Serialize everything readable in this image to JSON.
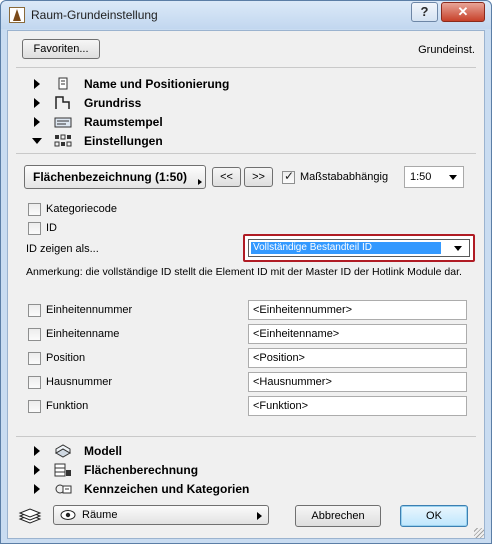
{
  "window": {
    "title": "Raum-Grundeinstellung",
    "help_label": "?",
    "close_label": "✕"
  },
  "header": {
    "favorites_label": "Favoriten...",
    "right_label": "Grundeinst."
  },
  "sections": {
    "name": "Name und Positionierung",
    "grundriss": "Grundriss",
    "raumstempel": "Raumstempel",
    "einstellungen": "Einstellungen",
    "modell": "Modell",
    "flaechen": "Flächenberechnung",
    "kennzeichen": "Kennzeichen und Kategorien"
  },
  "settings": {
    "area_button": "Flächenbezeichnung (1:50)",
    "prev_label": "<<",
    "next_label": ">>",
    "scale_dependent_label": "Maßstababhängig",
    "scale_dependent_checked": true,
    "scale_value": "1:50",
    "category_code_label": "Kategoriecode",
    "id_label": "ID",
    "show_id_as_label": "ID zeigen als...",
    "show_id_as_value": "Vollständige Bestandteil ID",
    "note": "Anmerkung: die vollständige ID stellt die Element ID mit der Master ID der Hotlink Module dar."
  },
  "fields": [
    {
      "label": "Einheitennummer",
      "value": "<Einheitennummer>"
    },
    {
      "label": "Einheitenname",
      "value": "<Einheitenname>"
    },
    {
      "label": "Position",
      "value": "<Position>"
    },
    {
      "label": "Hausnummer",
      "value": "<Hausnummer>"
    },
    {
      "label": "Funktion",
      "value": "<Funktion>"
    }
  ],
  "footer": {
    "views_label": "Räume",
    "cancel_label": "Abbrechen",
    "ok_label": "OK"
  },
  "colors": {
    "highlight": "#3399ff",
    "focus_border": "#b01b24"
  }
}
